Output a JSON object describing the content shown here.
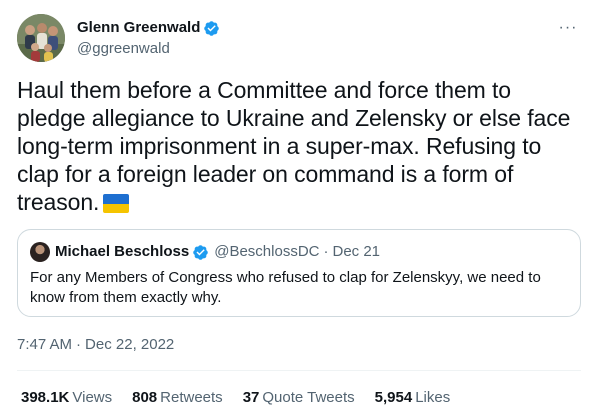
{
  "author": {
    "name": "Glenn Greenwald",
    "handle": "@ggreenwald"
  },
  "tweet": {
    "text": "Haul them before a Committee and force them to pledge allegiance to Ukraine and Zelensky or else face long-term imprisonment in a super-max. Refusing to clap for a foreign leader on command is a form of treason.",
    "flag_icon": "ukraine-flag-emoji",
    "time": "7:47 AM",
    "separator": "·",
    "date": "Dec 22, 2022"
  },
  "quoted": {
    "name": "Michael Beschloss",
    "handle": "@BeschlossDC",
    "separator": "·",
    "date": "Dec 21",
    "text": "For any Members of Congress who refused to clap for Zelenskyy, we need to know from them exactly why."
  },
  "stats": {
    "views_count": "398.1K",
    "views_label": "Views",
    "retweets_count": "808",
    "retweets_label": "Retweets",
    "quotes_count": "37",
    "quotes_label": "Quote Tweets",
    "likes_count": "5,954",
    "likes_label": "Likes"
  },
  "colors": {
    "verified_blue": "#1d9bf0",
    "secondary_text": "#536471",
    "primary_text": "#0f1419",
    "border": "#cfd9de"
  },
  "icons": {
    "more": "more-options-icon",
    "verified": "verified-badge-icon"
  },
  "more_glyph": "···"
}
